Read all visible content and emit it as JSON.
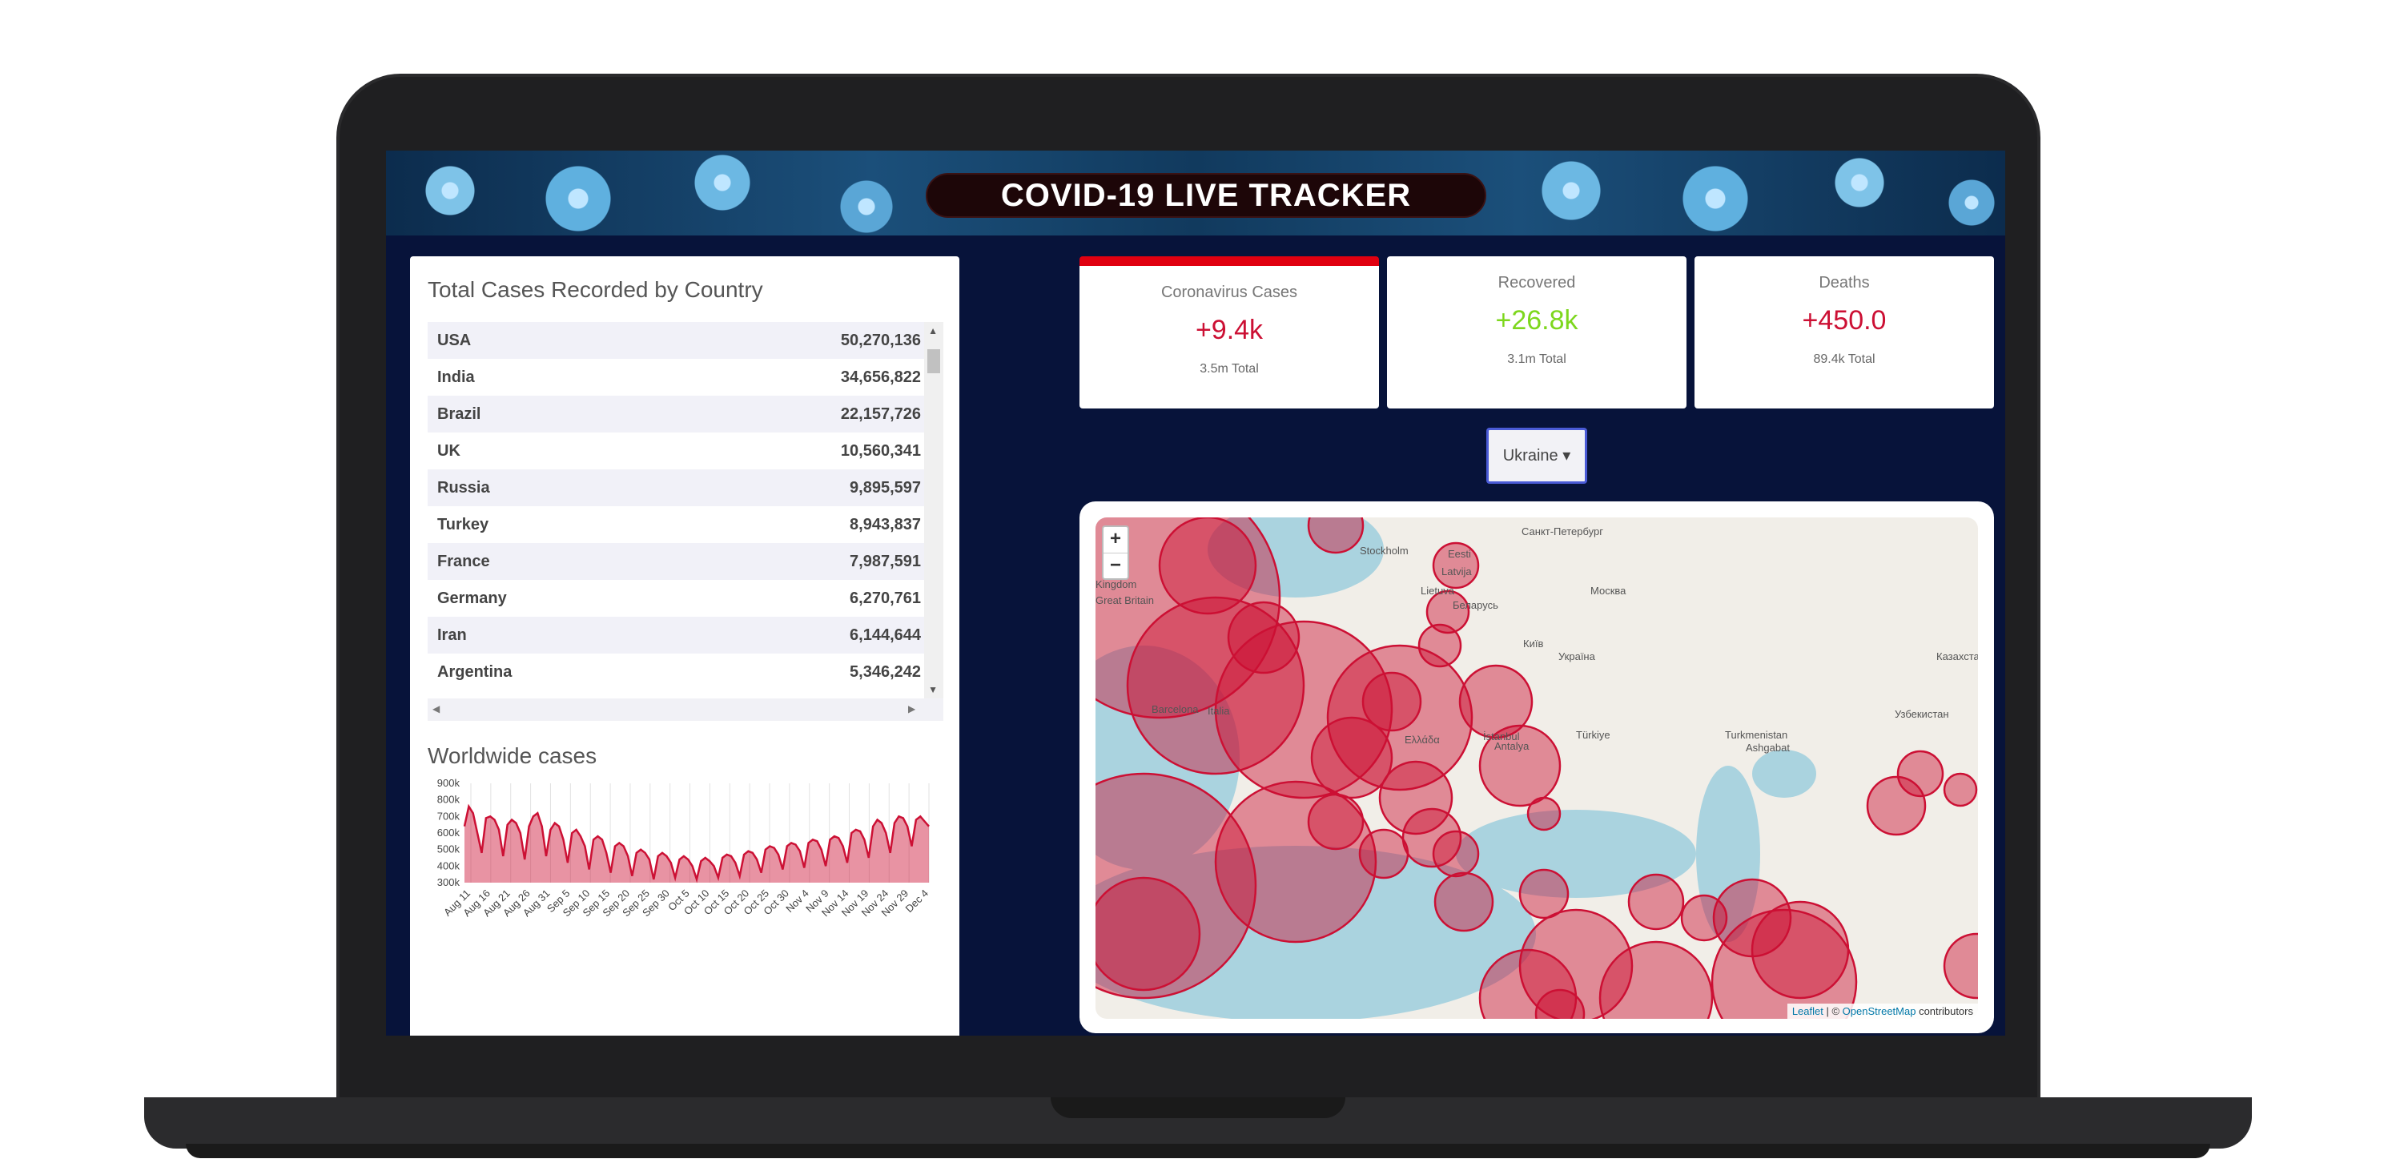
{
  "header": {
    "title": "COVID-19 LIVE TRACKER"
  },
  "country_table": {
    "title": "Total Cases Recorded by Country",
    "rows": [
      {
        "country": "USA",
        "cases": "50,270,136"
      },
      {
        "country": "India",
        "cases": "34,656,822"
      },
      {
        "country": "Brazil",
        "cases": "22,157,726"
      },
      {
        "country": "UK",
        "cases": "10,560,341"
      },
      {
        "country": "Russia",
        "cases": "9,895,597"
      },
      {
        "country": "Turkey",
        "cases": "8,943,837"
      },
      {
        "country": "France",
        "cases": "7,987,591"
      },
      {
        "country": "Germany",
        "cases": "6,270,761"
      },
      {
        "country": "Iran",
        "cases": "6,144,644"
      },
      {
        "country": "Argentina",
        "cases": "5,346,242"
      }
    ]
  },
  "worldwide_chart": {
    "title": "Worldwide cases",
    "color": "#cc1034"
  },
  "chart_data": {
    "type": "area",
    "title": "Worldwide cases",
    "ylim": [
      300000,
      900000
    ],
    "yticks": [
      "900k",
      "800k",
      "700k",
      "600k",
      "500k",
      "400k",
      "300k"
    ],
    "ytick_values": [
      900000,
      800000,
      700000,
      600000,
      500000,
      400000,
      300000
    ],
    "xticks": [
      "Aug 11",
      "Aug 16",
      "Aug 21",
      "Aug 26",
      "Aug 31",
      "Sep 5",
      "Sep 10",
      "Sep 15",
      "Sep 20",
      "Sep 25",
      "Sep 30",
      "Oct 5",
      "Oct 10",
      "Oct 15",
      "Oct 20",
      "Oct 25",
      "Oct 30",
      "Nov 4",
      "Nov 9",
      "Nov 14",
      "Nov 19",
      "Nov 24",
      "Nov 29",
      "Dec 4"
    ],
    "series": [
      {
        "values": [
          640000,
          760000,
          720000,
          600000,
          480000,
          690000,
          700000,
          680000,
          620000,
          460000,
          650000,
          680000,
          660000,
          600000,
          440000,
          640000,
          700000,
          720000,
          640000,
          460000,
          620000,
          660000,
          640000,
          560000,
          420000,
          600000,
          620000,
          580000,
          520000,
          380000,
          560000,
          580000,
          560000,
          480000,
          360000,
          520000,
          540000,
          520000,
          460000,
          340000,
          480000,
          500000,
          480000,
          440000,
          320000,
          460000,
          480000,
          460000,
          420000,
          330000,
          440000,
          460000,
          440000,
          400000,
          320000,
          430000,
          450000,
          430000,
          400000,
          330000,
          450000,
          470000,
          460000,
          420000,
          340000,
          470000,
          490000,
          480000,
          440000,
          360000,
          500000,
          520000,
          510000,
          470000,
          380000,
          520000,
          540000,
          530000,
          490000,
          390000,
          540000,
          560000,
          550000,
          500000,
          400000,
          560000,
          580000,
          570000,
          520000,
          420000,
          600000,
          620000,
          610000,
          560000,
          450000,
          640000,
          680000,
          660000,
          600000,
          480000,
          660000,
          700000,
          690000,
          640000,
          520000,
          680000,
          700000,
          670000,
          640000
        ]
      }
    ]
  },
  "stats": [
    {
      "label": "Coronavirus Cases",
      "value": "+9.4k",
      "total": "3.5m Total",
      "color": "#cc1034"
    },
    {
      "label": "Recovered",
      "value": "+26.8k",
      "total": "3.1m Total",
      "color": "#7dd71d"
    },
    {
      "label": "Deaths",
      "value": "+450.0",
      "total": "89.4k Total",
      "color": "#cc1034"
    }
  ],
  "country_select": {
    "selected": "Ukraine",
    "caret": "▾"
  },
  "map": {
    "zoom_in": "+",
    "zoom_out": "−",
    "attribution_leaflet": "Leaflet",
    "attribution_sep": " | © ",
    "attribution_osm": "OpenStreetMap",
    "attribution_tail": " contributors",
    "labels": [
      "Санкт-Петербург",
      "Stockholm",
      "Eesti",
      "Latvija",
      "Lietuva",
      "Беларусь",
      "Москва",
      "Київ",
      "Україна",
      "Kingdom",
      "Great Britain",
      "Barcelona",
      "Italia",
      "İstanbul",
      "Türkiye",
      "Antalya",
      "Ελλάδα",
      "Turkmenistan",
      "Ashgabat",
      "Казахстан",
      "Узбекистан"
    ],
    "circle_color": "#cc1034"
  }
}
